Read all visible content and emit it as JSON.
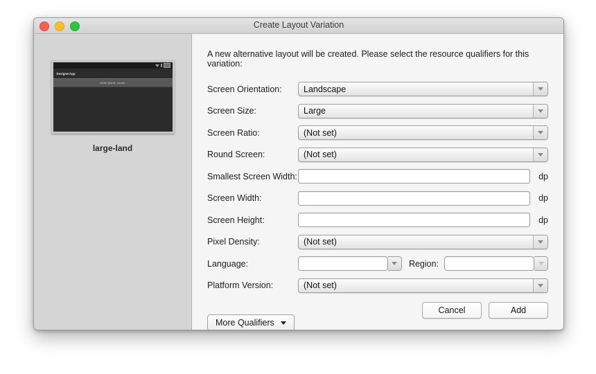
{
  "window": {
    "title": "Create Layout Variation",
    "traffic_lights": [
      "close-button",
      "minimize-button",
      "zoom-button"
    ]
  },
  "preview": {
    "caption": "large-land",
    "device": {
      "app_name": "DesignerApp",
      "strip_text": "Hello World, Lorem"
    }
  },
  "form": {
    "intro": "A new alternative layout will be created. Please select the resource qualifiers for this variation:",
    "rows": [
      {
        "label": "Screen Orientation:",
        "type": "combo",
        "value": "Landscape"
      },
      {
        "label": "Screen Size:",
        "type": "combo",
        "value": "Large"
      },
      {
        "label": "Screen Ratio:",
        "type": "combo",
        "value": "(Not set)"
      },
      {
        "label": "Round Screen:",
        "type": "combo",
        "value": "(Not set)"
      },
      {
        "label": "Smallest Screen Width:",
        "type": "text",
        "value": "",
        "unit": "dp"
      },
      {
        "label": "Screen Width:",
        "type": "text",
        "value": "",
        "unit": "dp"
      },
      {
        "label": "Screen Height:",
        "type": "text",
        "value": "",
        "unit": "dp"
      },
      {
        "label": "Pixel Density:",
        "type": "combo",
        "value": "(Not set)"
      },
      {
        "label": "Language:",
        "type": "language-region",
        "value": "",
        "region_label": "Region:",
        "region_value": ""
      },
      {
        "label": "Platform Version:",
        "type": "combo",
        "value": "(Not set)"
      }
    ],
    "more_qualifiers_label": "More Qualifiers"
  },
  "footer": {
    "cancel_label": "Cancel",
    "add_label": "Add"
  }
}
